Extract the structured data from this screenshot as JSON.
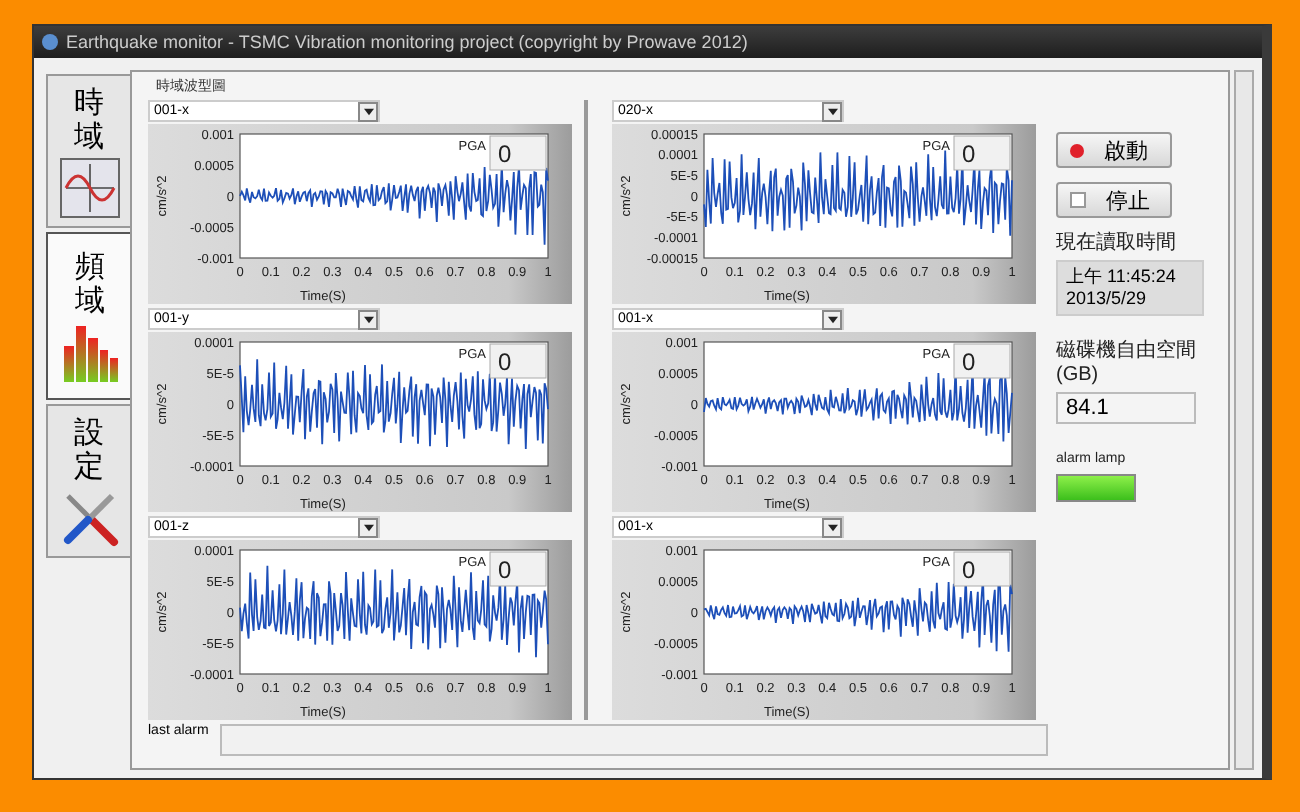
{
  "window": {
    "title": "Earthquake monitor - TSMC Vibration monitoring project (copyright by Prowave 2012)"
  },
  "tabs": [
    {
      "label": "時域",
      "selected": false,
      "kind": "sine"
    },
    {
      "label": "頻域",
      "selected": true,
      "kind": "bars"
    },
    {
      "label": "設定",
      "selected": false,
      "kind": "tools"
    }
  ],
  "panel_title": "時域波型圖",
  "charts": [
    {
      "channel": "001-x",
      "ylabel": "cm/s^2",
      "yticks": [
        "0.001",
        "0.0005",
        "0",
        "-0.0005",
        "-0.001"
      ],
      "xticks": [
        "0",
        "0.1",
        "0.2",
        "0.3",
        "0.4",
        "0.5",
        "0.6",
        "0.7",
        "0.8",
        "0.9",
        "1"
      ],
      "xlabel": "Time(S)",
      "pga_label": "PGA",
      "pga": "0",
      "kind": "growing"
    },
    {
      "channel": "001-y",
      "ylabel": "cm/s^2",
      "yticks": [
        "0.0001",
        "5E-5",
        "0",
        "-5E-5",
        "-0.0001"
      ],
      "xticks": [
        "0",
        "0.1",
        "0.2",
        "0.3",
        "0.4",
        "0.5",
        "0.6",
        "0.7",
        "0.8",
        "0.9",
        "1"
      ],
      "xlabel": "Time(S)",
      "pga_label": "PGA",
      "pga": "0",
      "kind": "steady"
    },
    {
      "channel": "001-z",
      "ylabel": "cm/s^2",
      "yticks": [
        "0.0001",
        "5E-5",
        "0",
        "-5E-5",
        "-0.0001"
      ],
      "xticks": [
        "0",
        "0.1",
        "0.2",
        "0.3",
        "0.4",
        "0.5",
        "0.6",
        "0.7",
        "0.8",
        "0.9",
        "1"
      ],
      "xlabel": "Time(S)",
      "pga_label": "PGA",
      "pga": "0",
      "kind": "steady"
    },
    {
      "channel": "020-x",
      "ylabel": "cm/s^2",
      "yticks": [
        "0.00015",
        "0.0001",
        "5E-5",
        "0",
        "-5E-5",
        "-0.0001",
        "-0.00015"
      ],
      "xticks": [
        "0",
        "0.1",
        "0.2",
        "0.3",
        "0.4",
        "0.5",
        "0.6",
        "0.7",
        "0.8",
        "0.9",
        "1"
      ],
      "xlabel": "Time(S)",
      "pga_label": "PGA",
      "pga": "0",
      "kind": "steady"
    },
    {
      "channel": "001-x",
      "ylabel": "cm/s^2",
      "yticks": [
        "0.001",
        "0.0005",
        "0",
        "-0.0005",
        "-0.001"
      ],
      "xticks": [
        "0",
        "0.1",
        "0.2",
        "0.3",
        "0.4",
        "0.5",
        "0.6",
        "0.7",
        "0.8",
        "0.9",
        "1"
      ],
      "xlabel": "Time(S)",
      "pga_label": "PGA",
      "pga": "0",
      "kind": "growing"
    },
    {
      "channel": "001-x",
      "ylabel": "cm/s^2",
      "yticks": [
        "0.001",
        "0.0005",
        "0",
        "-0.0005",
        "-0.001"
      ],
      "xticks": [
        "0",
        "0.1",
        "0.2",
        "0.3",
        "0.4",
        "0.5",
        "0.6",
        "0.7",
        "0.8",
        "0.9",
        "1"
      ],
      "xlabel": "Time(S)",
      "pga_label": "PGA",
      "pga": "0",
      "kind": "growing"
    }
  ],
  "buttons": [
    {
      "label": "啟動",
      "kind": "led"
    },
    {
      "label": "停止",
      "kind": "box"
    }
  ],
  "read_time": {
    "label": "現在讀取時間",
    "lines": [
      "上午 11:45:24",
      "2013/5/29"
    ]
  },
  "disk": {
    "label": "磁碟機自由空間(GB)",
    "value": "84.1"
  },
  "alarm_lamp": {
    "label": "alarm lamp",
    "on": true
  },
  "last_alarm": {
    "label": "last alarm"
  }
}
